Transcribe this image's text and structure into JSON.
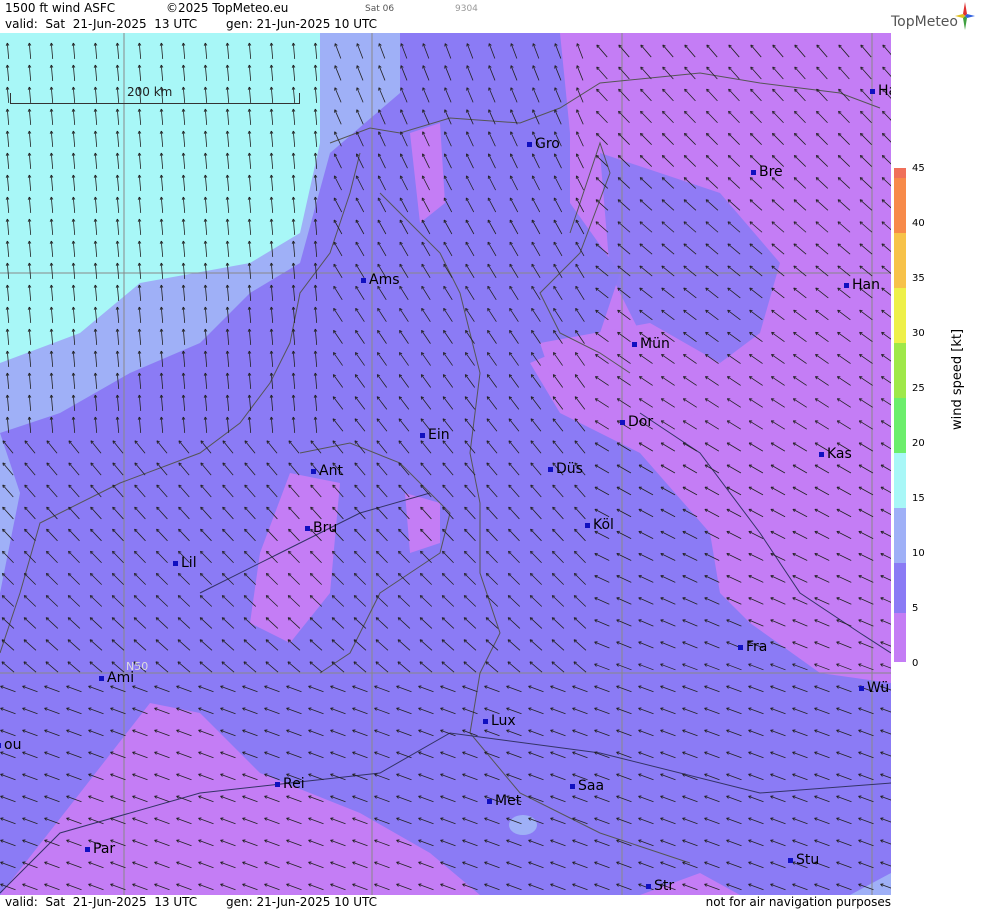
{
  "header": {
    "product": "1500 ft wind ASFC",
    "copyright": "©2025 TopMeteo.eu",
    "day_code": "Sat 06",
    "id_code": "9304",
    "valid": "valid:  Sat  21-Jun-2025  13 UTC",
    "gen": "gen: 21-Jun-2025 10 UTC",
    "logo": "TopMeteo"
  },
  "scale_bar": "200 km",
  "grid_label": "N50",
  "cities": [
    {
      "name": "Ha"
    },
    {
      "name": "Gro"
    },
    {
      "name": "Bre"
    },
    {
      "name": "Ams"
    },
    {
      "name": "Han"
    },
    {
      "name": "Mün"
    },
    {
      "name": "Dor"
    },
    {
      "name": "Ein"
    },
    {
      "name": "Kas"
    },
    {
      "name": "Düs"
    },
    {
      "name": "Ant"
    },
    {
      "name": "Köl"
    },
    {
      "name": "Bru"
    },
    {
      "name": "Lil"
    },
    {
      "name": "Fra"
    },
    {
      "name": "Ami"
    },
    {
      "name": "Wü"
    },
    {
      "name": "Lux"
    },
    {
      "name": "ou"
    },
    {
      "name": "Rei"
    },
    {
      "name": "Saa"
    },
    {
      "name": "Met"
    },
    {
      "name": "Par"
    },
    {
      "name": "Stu"
    },
    {
      "name": "Str"
    }
  ],
  "legend": {
    "title": "wind  speed  [kt]",
    "ticks": [
      "45",
      "40",
      "35",
      "30",
      "25",
      "20",
      "15",
      "10",
      "5",
      "0"
    ],
    "colors": {
      "c0_5": "#c47df5",
      "c5_10": "#8b7bf5",
      "c10_15": "#9fb0f7",
      "c15_20": "#a8f7f7",
      "c20_25": "#6cee6c",
      "c25_30": "#9fe84a",
      "c30_35": "#eef04a",
      "c35_40": "#f7c24a",
      "c40_45": "#f78a4a",
      "c45": "#f0705a"
    }
  },
  "footer": {
    "valid": "valid:  Sat  21-Jun-2025  13 UTC",
    "gen": "gen: 21-Jun-2025 10 UTC",
    "note": "not for air navigation purposes"
  }
}
